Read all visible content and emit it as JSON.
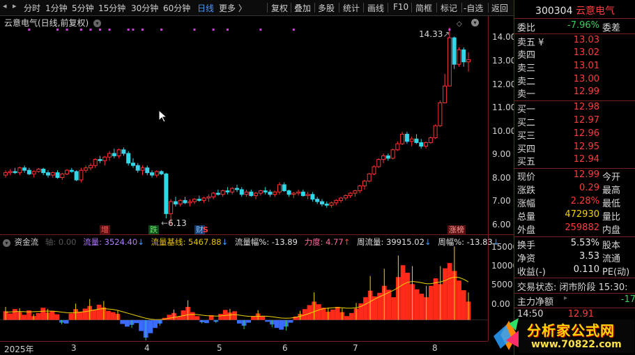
{
  "toolbar": {
    "periods": [
      "分时",
      "1分钟",
      "5分钟",
      "15分钟",
      "30分钟",
      "60分钟",
      "日线",
      "更多 〉"
    ],
    "active_period": "日线",
    "actions": [
      "复权",
      "叠加",
      "多股",
      "统计",
      "画线",
      "F10",
      "简框",
      "标记",
      "-自选",
      "返回"
    ]
  },
  "chart": {
    "title": "云意电气(日线,前复权)",
    "high_marker": "14.33",
    "low_marker": "6.13",
    "annotations": [
      "增",
      "跌",
      "财",
      "S",
      "涨榜"
    ],
    "price_ticks": [
      "14.00",
      "13.00",
      "12.00",
      "11.00",
      "10.00",
      "9.00",
      "8.00",
      "7.00",
      "6.00"
    ]
  },
  "flow": {
    "name": "资金流",
    "axis_label": "轴: 0.00",
    "flow_label": "流量: 3524.40",
    "base_label": "流量基线: 5467.88",
    "amp_label": "流量幅%: -13.89",
    "force_label": "力度: 4.77",
    "week_flow_label": "周流量: 39915.02",
    "week_amp_label": "周幅%: -13.83",
    "ticks": [
      "15000",
      "10000",
      "5000",
      "0.00"
    ]
  },
  "dates": [
    "2025年",
    "3",
    "4",
    "5",
    "6",
    "7",
    "8"
  ],
  "quote": {
    "code": "300304",
    "name": "云意电气",
    "weibi_label": "委比",
    "weibi_value": "-7.96%",
    "weicha_label": "委差",
    "asks": [
      {
        "label": "卖五 ¥",
        "price": "13.03"
      },
      {
        "label": "卖四",
        "price": "13.02"
      },
      {
        "label": "卖三",
        "price": "13.01"
      },
      {
        "label": "卖二",
        "price": "13.00"
      },
      {
        "label": "卖一",
        "price": "12.99"
      }
    ],
    "bids": [
      {
        "label": "买一",
        "price": "12.98"
      },
      {
        "label": "买二",
        "price": "12.97"
      },
      {
        "label": "买三",
        "price": "12.96"
      },
      {
        "label": "买四",
        "price": "12.95"
      },
      {
        "label": "买五",
        "price": "12.94"
      }
    ],
    "stats": [
      {
        "label": "现价",
        "value": "12.99",
        "tail": "今开",
        "color": "red"
      },
      {
        "label": "涨跌",
        "value": "0.29",
        "tail": "最高",
        "color": "red"
      },
      {
        "label": "涨幅",
        "value": "2.28%",
        "tail": "最低",
        "color": "red"
      },
      {
        "label": "总量",
        "value": "472930",
        "tail": "量比",
        "color": "yellow"
      },
      {
        "label": "外盘",
        "value": "259882",
        "tail": "内盘",
        "color": "red"
      }
    ],
    "stats2": [
      {
        "label": "换手",
        "value": "5.53%",
        "tail": "股本"
      },
      {
        "label": "净资",
        "value": "3.53",
        "tail": "流通"
      },
      {
        "label": "收益(-)",
        "value": "0.110",
        "tail": "PE(动)"
      }
    ],
    "trade_state": "交易状态: 闭市阶段 15:30:",
    "main_net_label": "主力净额",
    "main_net_value": "-17",
    "tick_time": "14:50",
    "tick_price": "12.91"
  },
  "watermark": {
    "text": "分析家公式网",
    "url": "www.70822.com"
  },
  "chart_data": {
    "type": "candlestick",
    "title": "云意电气(日线,前复权)",
    "ylim": [
      5.8,
      14.6
    ],
    "candles": [
      [
        8.2,
        8.4,
        8.1,
        8.3
      ],
      [
        8.3,
        8.45,
        8.2,
        8.35
      ],
      [
        8.35,
        8.5,
        8.25,
        8.3
      ],
      [
        8.3,
        8.55,
        8.2,
        8.5
      ],
      [
        8.5,
        8.6,
        8.3,
        8.4
      ],
      [
        8.4,
        8.5,
        8.2,
        8.25
      ],
      [
        8.25,
        8.4,
        8.1,
        8.35
      ],
      [
        8.35,
        8.5,
        8.3,
        8.45
      ],
      [
        8.45,
        8.5,
        8.2,
        8.3
      ],
      [
        8.3,
        8.4,
        8.1,
        8.2
      ],
      [
        8.2,
        8.35,
        8.1,
        8.3
      ],
      [
        8.3,
        8.4,
        8.05,
        8.1
      ],
      [
        8.1,
        8.3,
        8.0,
        8.25
      ],
      [
        8.25,
        8.45,
        8.2,
        8.4
      ],
      [
        8.4,
        8.5,
        8.3,
        8.35
      ],
      [
        8.35,
        8.4,
        7.95,
        8.0
      ],
      [
        8.0,
        8.5,
        7.9,
        8.4
      ],
      [
        8.4,
        8.6,
        8.3,
        8.5
      ],
      [
        8.5,
        8.7,
        8.4,
        8.6
      ],
      [
        8.6,
        8.9,
        8.5,
        8.85
      ],
      [
        8.85,
        9.0,
        8.7,
        8.8
      ],
      [
        8.8,
        9.0,
        8.6,
        8.95
      ],
      [
        8.95,
        9.2,
        8.8,
        9.1
      ],
      [
        9.1,
        9.3,
        8.9,
        9.0
      ],
      [
        9.0,
        9.3,
        8.9,
        9.25
      ],
      [
        9.25,
        9.35,
        9.0,
        9.1
      ],
      [
        9.1,
        9.2,
        8.6,
        8.7
      ],
      [
        8.7,
        8.9,
        8.5,
        8.6
      ],
      [
        8.6,
        8.7,
        8.3,
        8.4
      ],
      [
        8.4,
        8.6,
        8.2,
        8.5
      ],
      [
        8.5,
        8.6,
        8.2,
        8.3
      ],
      [
        8.3,
        8.4,
        8.1,
        8.2
      ],
      [
        8.2,
        8.4,
        8.1,
        8.35
      ],
      [
        8.35,
        8.4,
        8.2,
        8.25
      ],
      [
        8.25,
        8.3,
        6.4,
        6.6
      ],
      [
        6.6,
        7.2,
        6.13,
        7.1
      ],
      [
        7.1,
        7.3,
        6.9,
        7.0
      ],
      [
        7.0,
        7.2,
        6.9,
        7.15
      ],
      [
        7.15,
        7.3,
        7.0,
        7.05
      ],
      [
        7.05,
        7.2,
        6.9,
        7.1
      ],
      [
        7.1,
        7.25,
        7.0,
        7.2
      ],
      [
        7.2,
        7.35,
        7.1,
        7.15
      ],
      [
        7.15,
        7.3,
        7.05,
        7.25
      ],
      [
        7.25,
        7.4,
        7.1,
        7.3
      ],
      [
        7.3,
        7.5,
        7.2,
        7.45
      ],
      [
        7.45,
        7.6,
        7.35,
        7.4
      ],
      [
        7.4,
        7.6,
        7.3,
        7.55
      ],
      [
        7.55,
        7.7,
        7.4,
        7.5
      ],
      [
        7.5,
        7.7,
        7.4,
        7.65
      ],
      [
        7.65,
        7.8,
        7.5,
        7.6
      ],
      [
        7.6,
        7.7,
        7.3,
        7.4
      ],
      [
        7.4,
        7.6,
        7.3,
        7.5
      ],
      [
        7.5,
        7.6,
        7.3,
        7.35
      ],
      [
        7.35,
        7.5,
        7.2,
        7.45
      ],
      [
        7.45,
        7.6,
        7.35,
        7.55
      ],
      [
        7.55,
        7.7,
        7.4,
        7.5
      ],
      [
        7.5,
        7.6,
        7.3,
        7.4
      ],
      [
        7.4,
        7.55,
        7.3,
        7.5
      ],
      [
        7.5,
        7.9,
        7.4,
        7.8
      ],
      [
        7.8,
        7.9,
        7.5,
        7.55
      ],
      [
        7.55,
        7.6,
        7.3,
        7.4
      ],
      [
        7.4,
        7.5,
        7.25,
        7.45
      ],
      [
        7.45,
        7.6,
        7.35,
        7.5
      ],
      [
        7.5,
        7.6,
        7.3,
        7.35
      ],
      [
        7.35,
        7.5,
        7.2,
        7.4
      ],
      [
        7.4,
        7.5,
        7.1,
        7.2
      ],
      [
        7.2,
        7.3,
        7.0,
        7.1
      ],
      [
        7.1,
        7.2,
        6.9,
        7.0
      ],
      [
        7.0,
        7.1,
        6.85,
        6.95
      ],
      [
        6.95,
        7.1,
        6.85,
        7.05
      ],
      [
        7.05,
        7.2,
        6.95,
        7.15
      ],
      [
        7.15,
        7.3,
        7.05,
        7.25
      ],
      [
        7.25,
        7.4,
        7.15,
        7.35
      ],
      [
        7.35,
        7.5,
        7.25,
        7.45
      ],
      [
        7.45,
        7.6,
        7.3,
        7.55
      ],
      [
        7.55,
        7.8,
        7.45,
        7.75
      ],
      [
        7.75,
        8.0,
        7.6,
        7.95
      ],
      [
        7.95,
        8.3,
        7.9,
        8.25
      ],
      [
        8.25,
        8.6,
        8.2,
        8.55
      ],
      [
        8.55,
        8.9,
        8.5,
        8.85
      ],
      [
        8.85,
        9.1,
        8.7,
        9.0
      ],
      [
        9.0,
        9.1,
        8.8,
        8.9
      ],
      [
        8.9,
        9.3,
        8.85,
        9.25
      ],
      [
        9.25,
        9.6,
        9.2,
        9.5
      ],
      [
        9.5,
        10.0,
        9.45,
        9.9
      ],
      [
        9.9,
        10.0,
        9.5,
        9.6
      ],
      [
        9.6,
        9.8,
        9.4,
        9.7
      ],
      [
        9.7,
        9.9,
        9.5,
        9.55
      ],
      [
        9.55,
        9.7,
        9.3,
        9.4
      ],
      [
        9.4,
        9.6,
        9.3,
        9.55
      ],
      [
        9.55,
        9.8,
        9.5,
        9.75
      ],
      [
        9.75,
        10.3,
        9.7,
        10.25
      ],
      [
        10.25,
        11.3,
        10.2,
        11.2
      ],
      [
        11.2,
        12.4,
        11.3,
        11.9
      ],
      [
        11.9,
        14.33,
        12.9,
        13.9
      ],
      [
        13.9,
        13.95,
        12.6,
        12.8
      ],
      [
        12.8,
        13.5,
        12.7,
        13.4
      ],
      [
        13.4,
        13.5,
        12.7,
        12.9
      ],
      [
        12.9,
        13.3,
        12.5,
        12.99
      ]
    ],
    "flow_ylim": [
      -4000,
      17000
    ],
    "flow_values": [
      2000,
      1500,
      2500,
      1800,
      1200,
      2200,
      900,
      1600,
      2800,
      1700,
      2100,
      1300,
      -600,
      -800,
      1500,
      2500,
      1900,
      2600,
      3200,
      2400,
      3500,
      2900,
      2100,
      1800,
      1400,
      -900,
      -1500,
      -1100,
      -700,
      -2500,
      -4000,
      -3000,
      -1800,
      -800,
      500,
      1200,
      1600,
      800,
      2200,
      3000,
      1800,
      900,
      -500,
      -700,
      1100,
      -400,
      1400,
      2300,
      1700,
      2000,
      -800,
      -1300,
      -600,
      900,
      1500,
      800,
      -400,
      -1000,
      -1800,
      -2200,
      -1500,
      -600,
      800,
      1400,
      2500,
      3400,
      4200,
      3600,
      2800,
      1900,
      2400,
      3000,
      1800,
      900,
      1600,
      2600,
      3800,
      5200,
      6700,
      5400,
      6200,
      7800,
      6900,
      5200,
      9800,
      12500,
      10800,
      8200,
      7000,
      6000,
      5200,
      7800,
      9500,
      8200,
      11800,
      13000,
      11200,
      9000,
      6800,
      4200
    ],
    "flow_base": [
      1800,
      1850,
      1900,
      1950,
      1900,
      1850,
      1900,
      1950,
      2000,
      2050,
      2000,
      1950,
      1800,
      1700,
      1650,
      1700,
      1800,
      1900,
      2100,
      2300,
      2500,
      2600,
      2500,
      2400,
      2200,
      1900,
      1600,
      1300,
      1000,
      700,
      400,
      200,
      100,
      100,
      200,
      400,
      600,
      800,
      1000,
      1200,
      1300,
      1250,
      1100,
      1000,
      950,
      900,
      950,
      1050,
      1150,
      1250,
      1100,
      950,
      850,
      800,
      850,
      900,
      850,
      750,
      600,
      450,
      400,
      450,
      600,
      850,
      1150,
      1500,
      1900,
      2300,
      2600,
      2700,
      2800,
      2850,
      2800,
      2700,
      2700,
      2800,
      3100,
      3600,
      4200,
      4800,
      5300,
      5800,
      6300,
      6800,
      7400,
      8100,
      8600,
      8800,
      8700,
      8500,
      8300,
      8300,
      8500,
      8700,
      9000,
      9500,
      9800,
      9700,
      9300,
      8700
    ]
  }
}
